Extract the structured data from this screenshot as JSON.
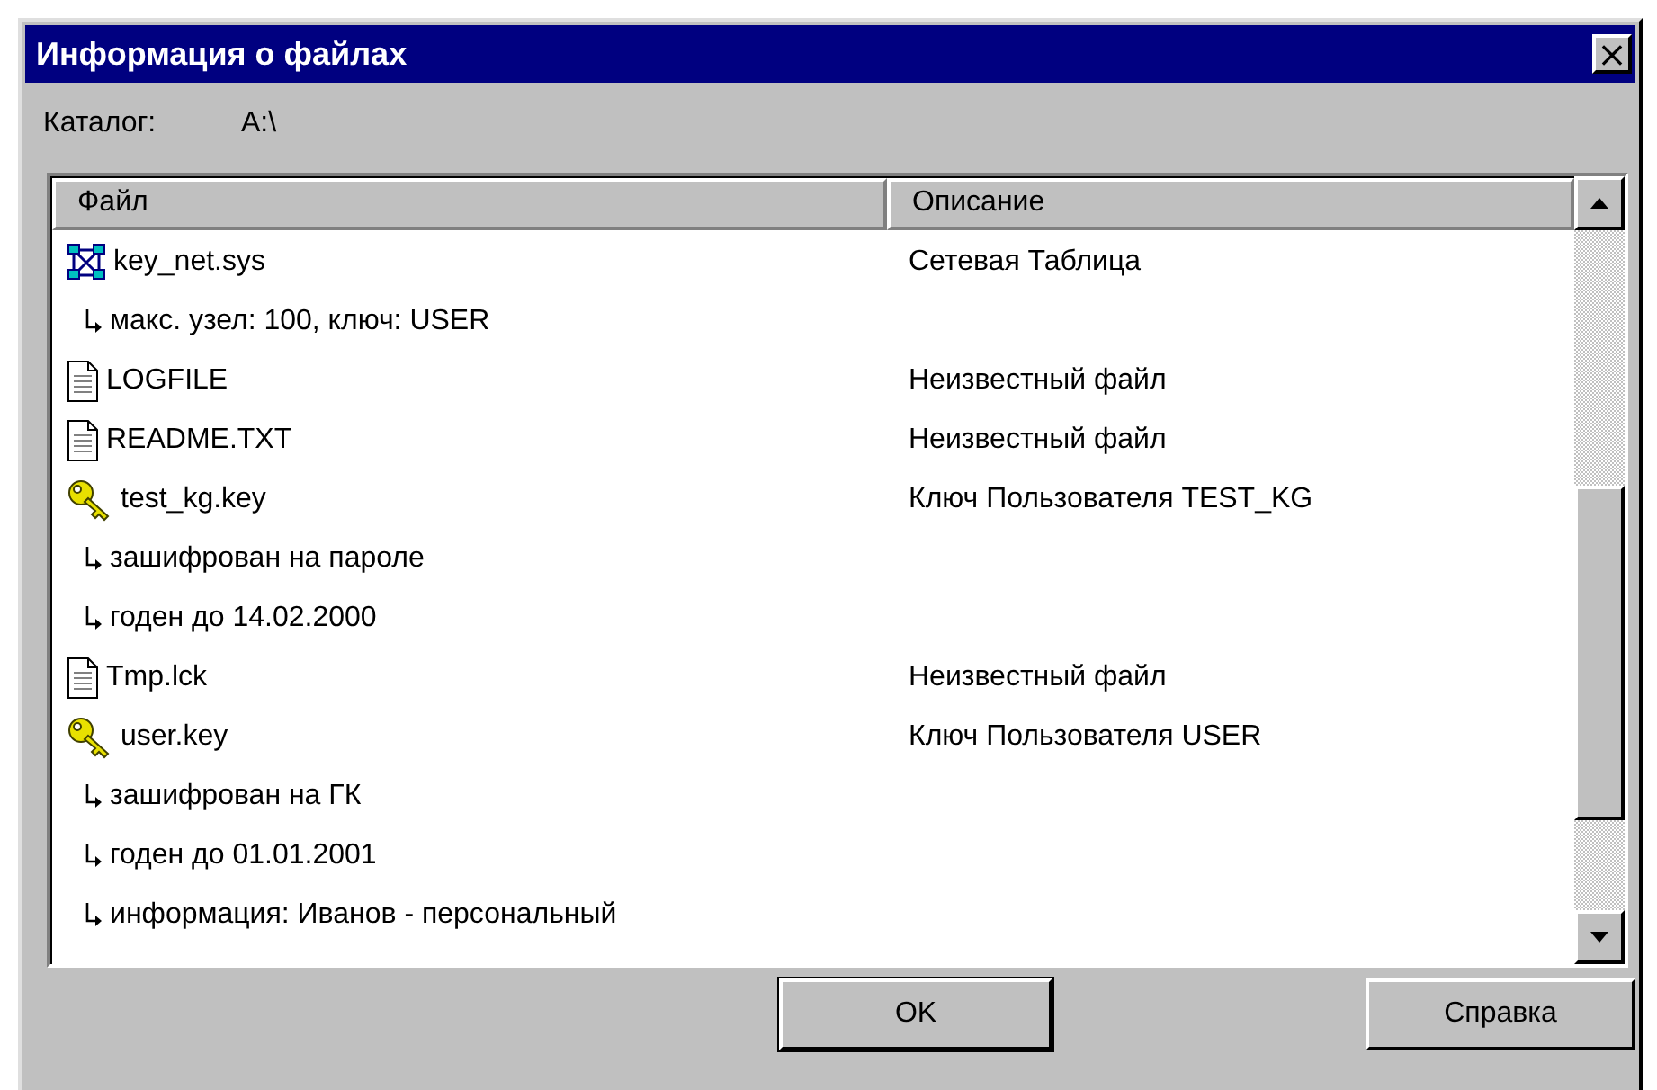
{
  "window": {
    "title": "Информация о файлах",
    "close": "×"
  },
  "catalog": {
    "label": "Каталог:",
    "value": "A:\\"
  },
  "table": {
    "columns": [
      "Файл",
      "Описание"
    ],
    "files": [
      {
        "kind": "network",
        "name": "key_net.sys",
        "description": "Сетевая Таблица",
        "children": [
          {
            "text": "макс. узел: 100, ключ: USER"
          }
        ]
      },
      {
        "kind": "document",
        "name": "LOGFILE",
        "description": "Неизвестный файл"
      },
      {
        "kind": "document",
        "name": "README.TXT",
        "description": "Неизвестный файл"
      },
      {
        "kind": "key",
        "name": "test_kg.key",
        "description": "Ключ Пользователя TEST_KG",
        "children": [
          {
            "text": "зашифрован на пароле"
          },
          {
            "text": "годен до 14.02.2000"
          }
        ]
      },
      {
        "kind": "document",
        "name": "Tmp.lck",
        "description": "Неизвестный файл"
      },
      {
        "kind": "key",
        "name": "user.key",
        "description": "Ключ Пользователя USER",
        "children": [
          {
            "text": "зашифрован на ГК"
          },
          {
            "text": "годен до 01.01.2001"
          },
          {
            "text": "информация: Иванов - персональный"
          }
        ]
      }
    ]
  },
  "buttons": [
    {
      "label": "OK",
      "default": true
    },
    {
      "label": "Справка",
      "default": false
    }
  ]
}
